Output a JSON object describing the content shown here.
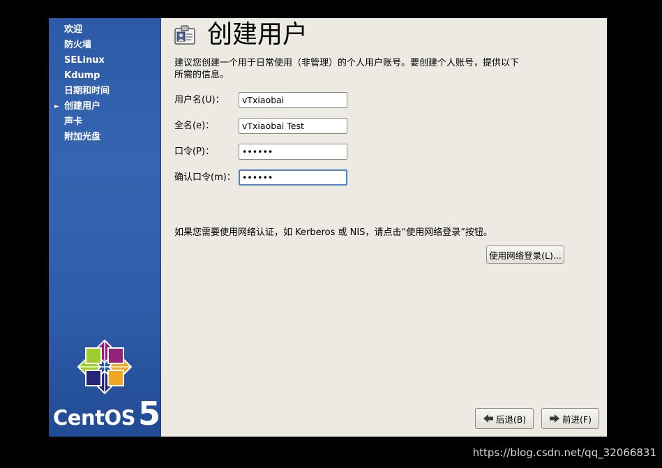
{
  "sidebar": {
    "items": [
      {
        "label": "欢迎",
        "active": false
      },
      {
        "label": "防火墙",
        "active": false
      },
      {
        "label": "SELinux",
        "active": false
      },
      {
        "label": "Kdump",
        "active": false
      },
      {
        "label": "日期和时间",
        "active": false
      },
      {
        "label": "创建用户",
        "active": true
      },
      {
        "label": "声卡",
        "active": false
      },
      {
        "label": "附加光盘",
        "active": false
      }
    ],
    "brand_word": "CentOS",
    "brand_number": "5"
  },
  "main": {
    "title": "创建用户",
    "title_icon": "user-badge-icon",
    "description": "建议您创建一个用于日常使用（非管理）的个人用户账号。要创建个人账号，提供以下所需的信息。",
    "fields": {
      "username": {
        "label": "用户名(U)：",
        "value": "vTxiaobai"
      },
      "fullname": {
        "label": "全名(e)：",
        "value": "vTxiaobai Test"
      },
      "password": {
        "label": "口令(P)：",
        "value": "••••••"
      },
      "confirm": {
        "label": "确认口令(m)：",
        "value": "••••••"
      }
    },
    "network_note": "如果您需要使用网络认证，如 Kerberos 或 NIS，请点击“使用网络登录”按钮。",
    "network_button": "使用网络登录(L)...",
    "back_button": "后退(B)",
    "forward_button": "前进(F)"
  },
  "colors": {
    "sidebar_blue": "#2d5aa6",
    "background": "#edeae4",
    "focus_border": "#5081c4"
  },
  "watermark": "https://blog.csdn.net/qq_32066831"
}
